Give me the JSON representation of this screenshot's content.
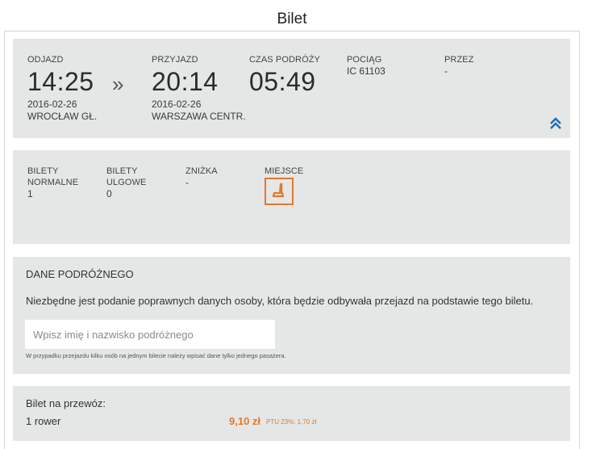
{
  "page_title": "Bilet",
  "journey": {
    "departure_label": "ODJAZD",
    "departure_time": "14:25",
    "departure_date": "2016-02-26",
    "departure_station": "WROCŁAW GŁ.",
    "arrow_glyph": "»",
    "arrival_label": "PRZYJAZD",
    "arrival_time": "20:14",
    "arrival_date": "2016-02-26",
    "arrival_station": "WARSZAWA CENTR.",
    "duration_label": "CZAS PODRÓŻY",
    "duration": "05:49",
    "train_label": "POCIĄG",
    "train": "IC 61103",
    "via_label": "PRZEZ",
    "via": "-",
    "collapse_icon": "double-chevron-up-icon"
  },
  "tickets": {
    "normal_label_line1": "BILETY",
    "normal_label_line2": "NORMALNE",
    "normal_count": "1",
    "reduced_label_line1": "BILETY",
    "reduced_label_line2": "ULGOWE",
    "reduced_count": "0",
    "discount_label": "ZNIŻKA",
    "discount": "-",
    "seat_label": "MIEJSCE",
    "seat_icon": "seat-icon"
  },
  "passenger": {
    "title": "DANE PODRÓŻNEGO",
    "description": "Niezbędne jest podanie poprawnych danych osoby, która będzie odbywała przejazd na podstawie tego biletu.",
    "name_placeholder": "Wpisz imię i nazwisko podróżnego",
    "name_value": "",
    "note": "W przypadku przejazdu kilku osób na jednym bilecie należy wpisać dane tylko jednego pasażera."
  },
  "transport": {
    "title": "Bilet na przewóz:",
    "item": "1 rower",
    "price": "9,10 zł",
    "vat": "PTU 23%: 1,70 zł"
  },
  "colors": {
    "accent": "#e07a2a",
    "link": "#1a6fb5",
    "panel_bg": "#e5e6e6"
  }
}
